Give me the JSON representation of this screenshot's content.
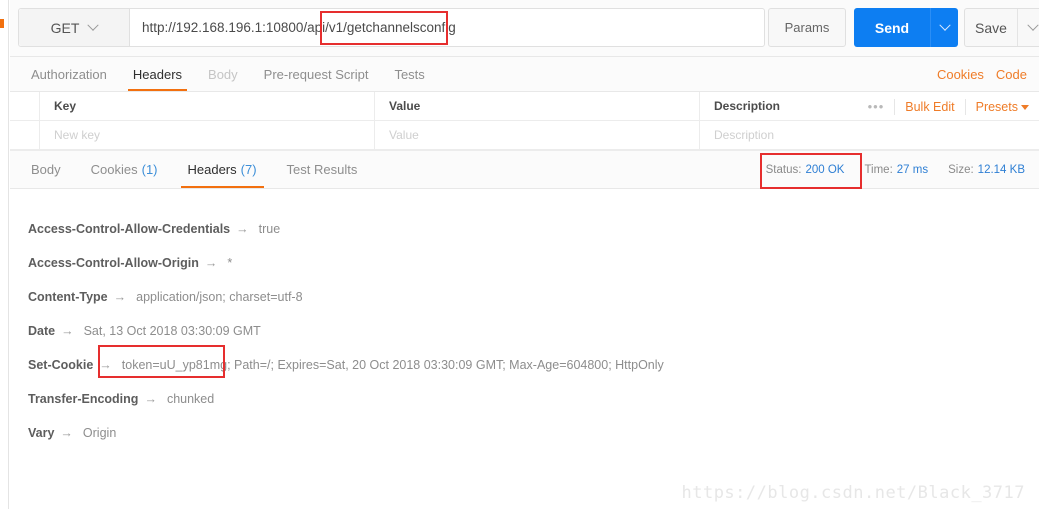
{
  "left_rail": {
    "accent_color": "#f2700f"
  },
  "request": {
    "method": "GET",
    "url": "http://192.168.196.1:10800/api/v1/getchannelsconfig",
    "params_label": "Params",
    "send_label": "Send",
    "save_label": "Save",
    "send_color": "#0d7ef2",
    "tabs": [
      {
        "label": "Authorization",
        "state": "normal"
      },
      {
        "label": "Headers",
        "state": "active"
      },
      {
        "label": "Body",
        "state": "muted"
      },
      {
        "label": "Pre-request Script",
        "state": "normal"
      },
      {
        "label": "Tests",
        "state": "normal"
      }
    ],
    "links": [
      {
        "label": "Cookies"
      },
      {
        "label": "Code"
      }
    ],
    "accent_color": "#ef7c28"
  },
  "headers_table": {
    "columns": [
      "Key",
      "Value",
      "Description"
    ],
    "placeholder_row": [
      "New key",
      "Value",
      "Description"
    ],
    "dots_label": "•••",
    "bulk_edit_label": "Bulk Edit",
    "presets_label": "Presets"
  },
  "response": {
    "tabs": [
      {
        "label": "Body",
        "count": "",
        "state": "normal"
      },
      {
        "label": "Cookies",
        "count": "(1)",
        "state": "normal"
      },
      {
        "label": "Headers",
        "count": "(7)",
        "state": "active"
      },
      {
        "label": "Test Results",
        "count": "",
        "state": "normal"
      }
    ],
    "meta": {
      "status_label": "Status:",
      "status_value": "200 OK",
      "time_label": "Time:",
      "time_value": "27 ms",
      "size_label": "Size:",
      "size_value": "12.14 KB",
      "value_color": "#2e7fd4"
    },
    "headers": [
      {
        "name": "Access-Control-Allow-Credentials",
        "arrow": "→",
        "value": "true"
      },
      {
        "name": "Access-Control-Allow-Origin",
        "arrow": "→",
        "value": "*"
      },
      {
        "name": "Content-Type",
        "arrow": "→",
        "value": "application/json; charset=utf-8"
      },
      {
        "name": "Date",
        "arrow": "→",
        "value": "Sat, 13 Oct 2018 03:30:09 GMT"
      },
      {
        "name": "Set-Cookie",
        "arrow": "→",
        "value": "token=uU_yp81mg; Path=/; Expires=Sat, 20 Oct 2018 03:30:09 GMT; Max-Age=604800; HttpOnly"
      },
      {
        "name": "Transfer-Encoding",
        "arrow": "→",
        "value": "chunked"
      },
      {
        "name": "Vary",
        "arrow": "→",
        "value": "Origin"
      }
    ]
  },
  "annotations": {
    "color": "#e62e2e",
    "boxes": [
      {
        "target": "url-suffix"
      },
      {
        "target": "status"
      },
      {
        "target": "set-cookie-token"
      }
    ]
  },
  "watermark": {
    "text": "https://blog.csdn.net/Black_3717"
  }
}
